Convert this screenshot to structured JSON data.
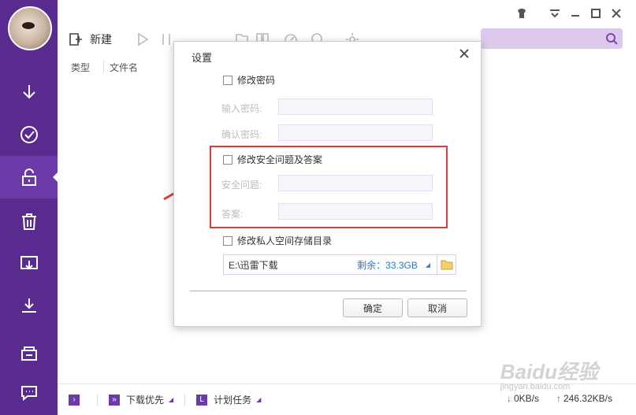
{
  "toolbar": {
    "new_label": "新建"
  },
  "columns": {
    "type": "类型",
    "filename": "文件名"
  },
  "dialog": {
    "title": "设置",
    "change_password": "修改密码",
    "enter_password_label": "输入密码:",
    "confirm_password_label": "确认密码:",
    "change_security": "修改安全问题及答案",
    "security_question_label": "安全问题:",
    "answer_label": "答案:",
    "change_storage": "修改私人空间存储目录",
    "path": "E:\\迅雷下载",
    "free_space": "剩余：33.3GB",
    "ok": "确定",
    "cancel": "取消"
  },
  "statusbar": {
    "priority": "下载优先",
    "schedule": "计划任务",
    "download_speed": "0KB/s",
    "upload_speed": "246.32KB/s"
  },
  "watermark": {
    "brand": "Baidu经验",
    "url": "jingyan.baidu.com"
  },
  "colors": {
    "sidebar": "#5a2b8e",
    "accent": "#7a46b4",
    "highlight_box": "#e23a3a"
  }
}
